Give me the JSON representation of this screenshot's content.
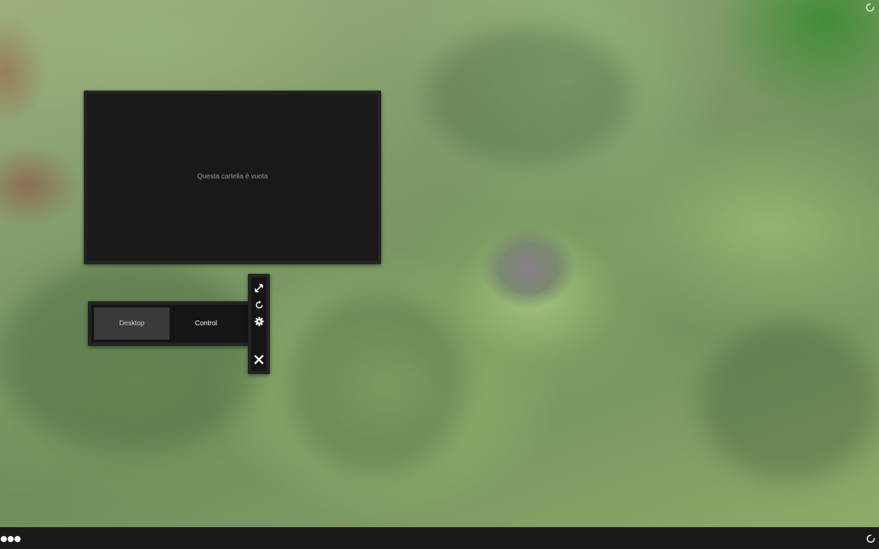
{
  "folder_view": {
    "empty_message": "Questa cartella è vuota"
  },
  "activity_switcher": {
    "items": [
      {
        "label": "Desktop",
        "active": true
      },
      {
        "label": "Control",
        "active": false
      }
    ]
  },
  "toolbar": {
    "tools": [
      {
        "icon": "resize-icon"
      },
      {
        "icon": "rotate-icon"
      },
      {
        "icon": "gear-icon"
      },
      {
        "icon": "close-icon"
      }
    ]
  },
  "taskbar": {
    "launcher_icon": "three-dots-menu-icon",
    "tray_icon": "busy-spinner-icon"
  },
  "colors": {
    "panel": "#232323",
    "panel_inner": "#191919",
    "active_tab": "#3a3a3a",
    "taskbar": "#1a1a1a"
  }
}
